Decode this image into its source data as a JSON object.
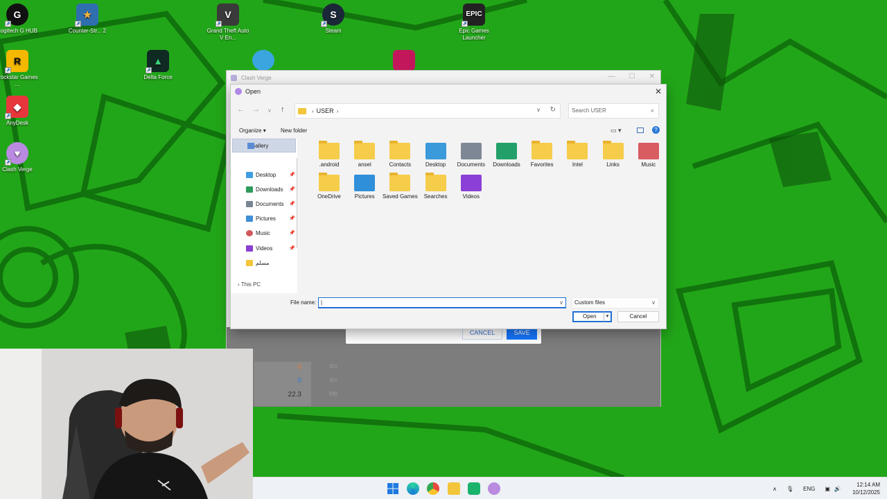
{
  "desktop": {
    "icons": [
      {
        "label": "Logitech G HUB",
        "name": "logitech-ghub-icon",
        "color": "#111111",
        "glyph": "G"
      },
      {
        "label": "Counter-Str... 2",
        "name": "counter-strike-icon",
        "color": "#2f6fb0",
        "glyph": "★"
      },
      {
        "label": "Grand Theft Auto V En...",
        "name": "gta-v-icon",
        "color": "#3a3a3a",
        "glyph": "V"
      },
      {
        "label": "Steam",
        "name": "steam-icon",
        "color": "#1b2838",
        "glyph": "S"
      },
      {
        "label": "Epic Games Launcher",
        "name": "epic-games-icon",
        "color": "#222222",
        "glyph": "E"
      },
      {
        "label": "Rockstar Games ...",
        "name": "rockstar-icon",
        "color": "#f5b800",
        "glyph": "R"
      },
      {
        "label": "Delta Force",
        "name": "delta-force-icon",
        "color": "#0f2a22",
        "glyph": "▲"
      },
      {
        "label": "AnyDesk",
        "name": "anydesk-icon",
        "color": "#e8363d",
        "glyph": "◆"
      },
      {
        "label": "Clash Verge",
        "name": "clash-verge-icon",
        "color": "#b98ae0",
        "glyph": "♥"
      }
    ]
  },
  "clash_window": {
    "title": "Clash Verge",
    "cancel_label": "CANCEL",
    "save_label": "SAVE",
    "stats": [
      {
        "value": "0",
        "unit": "B/s",
        "color": "#e07a3a"
      },
      {
        "value": "0",
        "unit": "B/s",
        "color": "#2e7fd6"
      },
      {
        "value": "22.3",
        "unit": "MB",
        "color": "#333333"
      }
    ]
  },
  "dialog": {
    "title": "Open",
    "breadcrumb": "USER",
    "search_placeholder": "Search USER",
    "organize_label": "Organize",
    "new_folder_label": "New folder",
    "nav_gallery": "Gallery",
    "nav_items": [
      {
        "label": "Desktop",
        "color": "#3f9ee0"
      },
      {
        "label": "Downloads",
        "color": "#2d9b5a"
      },
      {
        "label": "Documents",
        "color": "#7a8594"
      },
      {
        "label": "Pictures",
        "color": "#3f8ed6"
      },
      {
        "label": "Music",
        "color": "#d1575b"
      },
      {
        "label": "Videos",
        "color": "#8a3fd0"
      },
      {
        "label": "مسلم",
        "color": "#f3c53a"
      }
    ],
    "nav_this_pc": "This PC",
    "files": [
      {
        "label": ".android",
        "kind": "folder"
      },
      {
        "label": "ansel",
        "kind": "folder"
      },
      {
        "label": "Contacts",
        "kind": "folder"
      },
      {
        "label": "Desktop",
        "kind": "desktop"
      },
      {
        "label": "Documents",
        "kind": "documents"
      },
      {
        "label": "Downloads",
        "kind": "downloads"
      },
      {
        "label": "Favorites",
        "kind": "folder"
      },
      {
        "label": "Intel",
        "kind": "folder"
      },
      {
        "label": "Links",
        "kind": "folder"
      },
      {
        "label": "Music",
        "kind": "music"
      },
      {
        "label": "OneDrive",
        "kind": "folder"
      },
      {
        "label": "Pictures",
        "kind": "pictures"
      },
      {
        "label": "Saved Games",
        "kind": "folder"
      },
      {
        "label": "Searches",
        "kind": "folder"
      },
      {
        "label": "Videos",
        "kind": "videos"
      }
    ],
    "file_name_label": "File name:",
    "file_name_value": "",
    "file_type": "Custom files",
    "open_label": "Open",
    "cancel_label": "Cancel"
  },
  "taskbar": {
    "language": "ENG",
    "time": "12:14 AM",
    "date": "10/12/2025"
  }
}
